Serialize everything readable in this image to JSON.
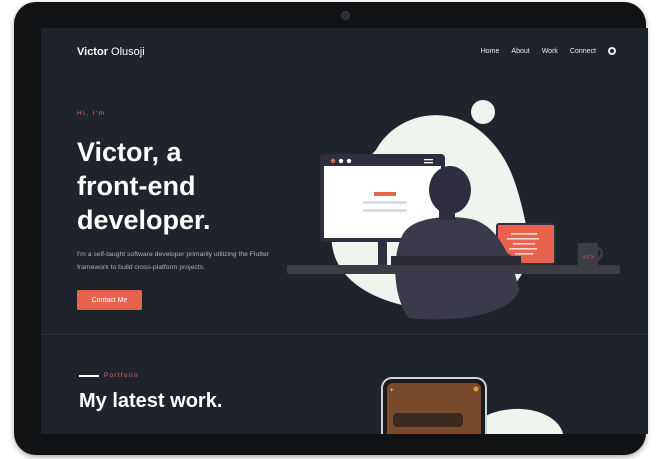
{
  "brand": {
    "first": "Victor",
    "last": " Olusoji"
  },
  "nav": {
    "items": [
      "Home",
      "About",
      "Work",
      "Connect"
    ],
    "github_icon": "github-icon"
  },
  "hero": {
    "greeting": "Hi, I'm",
    "headline": [
      "Victor, a",
      "front-end",
      "developer."
    ],
    "description": "I'm a self-taught software developer primarily utilizing the Flutter framework to build cross-platform projects.",
    "cta": "Contact Me"
  },
  "portfolio": {
    "label": "Portfolio",
    "title": "My latest work."
  },
  "colors": {
    "background": "#1e232c",
    "accent": "#e8634e",
    "blob": "#eef5ee"
  }
}
